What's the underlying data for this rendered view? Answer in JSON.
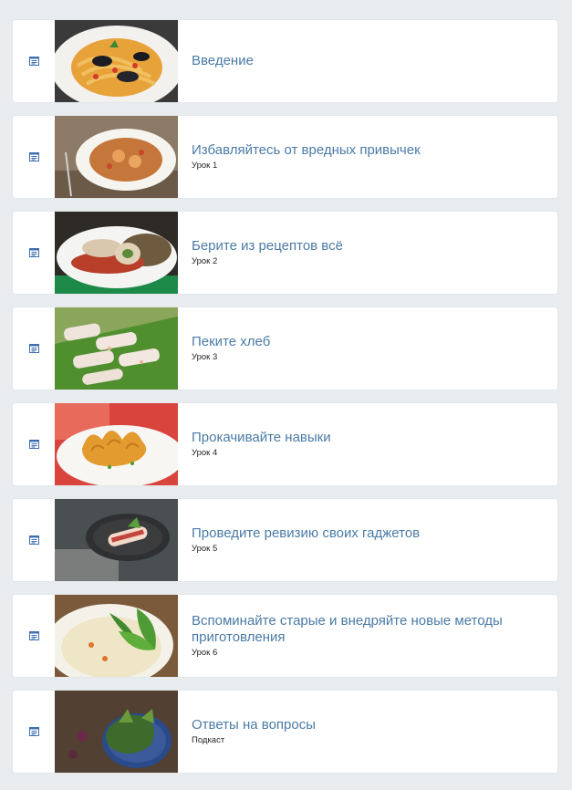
{
  "colors": {
    "page_bg": "#e9ecef",
    "title": "#4a7ba7",
    "icon": "#3d6fae"
  },
  "lessons": [
    {
      "title": "Введение",
      "subtitle": "",
      "icon": "document-icon",
      "image": "pasta-with-mussels"
    },
    {
      "title": "Избавляйтесь от вредных привычек",
      "subtitle": "Урок 1",
      "icon": "document-icon",
      "image": "risotto-with-shrimp"
    },
    {
      "title": "Берите из рецептов всё",
      "subtitle": "Урок 2",
      "icon": "document-icon",
      "image": "meat-rolls-with-lentils"
    },
    {
      "title": "Пеките хлеб",
      "subtitle": "Урок 3",
      "icon": "document-icon",
      "image": "spring-rolls-on-leaf"
    },
    {
      "title": "Прокачивайте навыки",
      "subtitle": "Урок 4",
      "icon": "document-icon",
      "image": "fried-dumplings"
    },
    {
      "title": "Проведите ревизию своих гаджетов",
      "subtitle": "Урок 5",
      "icon": "document-icon",
      "image": "wrapped-rolls-on-slate"
    },
    {
      "title": "Вспоминайте старые и внедряйте новые методы приготовления",
      "subtitle": "Урок 6",
      "icon": "document-icon",
      "image": "creamy-soup-with-herbs"
    },
    {
      "title": "Ответы на вопросы",
      "subtitle": "Подкаст",
      "icon": "document-icon",
      "image": "salad-greens-on-plate"
    }
  ]
}
